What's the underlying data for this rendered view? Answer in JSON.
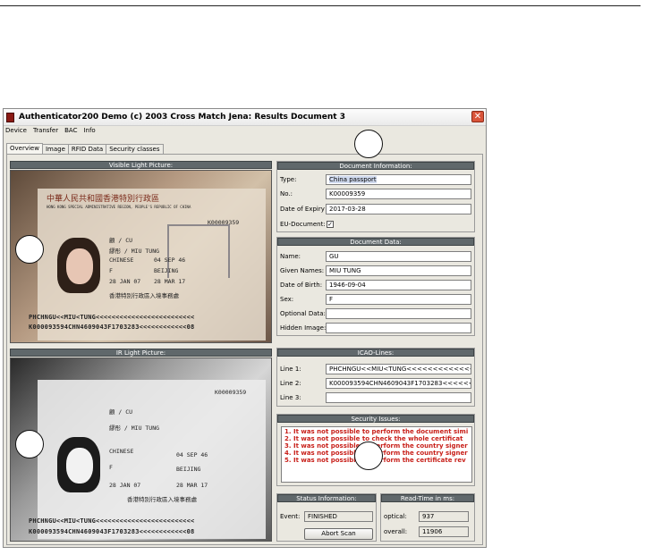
{
  "window": {
    "title": "Authenticator200 Demo (c) 2003 Cross Match Jena: Results Document 3",
    "close_glyph": "✕"
  },
  "menu": [
    "Device",
    "Transfer",
    "BAC",
    "Info"
  ],
  "tabs": [
    "Overview",
    "Image",
    "RFID Data",
    "Security classes"
  ],
  "visible_light": {
    "header": "Visible Light Picture:",
    "mrz1": "PHCHNGU<<MIU<TUNG<<<<<<<<<<<<<<<<<<<<<<<<<",
    "mrz2": "K000093594CHN4609043F1703283<<<<<<<<<<<<08",
    "passport_title": "中華人民共和國香港特別行政區",
    "passport_subtitle": "HONG KONG SPECIAL ADMINISTRATIVE REGION, PEOPLE'S REPUBLIC OF CHINA",
    "name_cn": "顧 / CU",
    "name_en": "繆彤 / MIU TUNG",
    "nationality": "CHINESE",
    "dob": "04 SEP 46",
    "sex": "F",
    "place": "BEIJING",
    "issue": "28 JAN 07",
    "expiry": "28 MAR 17",
    "number": "K00009359",
    "authority": "香港特別行政區入境事務處"
  },
  "ir_light": {
    "header": "IR Light Picture:",
    "mrz1": "PHCHNGU<<MIU<TUNG<<<<<<<<<<<<<<<<<<<<<<<<<",
    "mrz2": "K000093594CHN4609043F1703283<<<<<<<<<<<<08",
    "name_cn": "顧 / CU",
    "name_en": "繆彤 / MIU TUNG",
    "nationality": "CHINESE",
    "dob": "04 SEP 46",
    "sex": "F",
    "place": "BEIJING",
    "issue": "28 JAN 07",
    "expiry": "28 MAR 17",
    "number": "K00009359",
    "authority": "香港特別行政區入境事務處"
  },
  "document_information": {
    "header": "Document Information:",
    "type_label": "Type:",
    "type_value": "China passport",
    "no_label": "No.:",
    "no_value": "K00009359",
    "expiry_label": "Date of Expiry",
    "expiry_value": "2017-03-28",
    "eu_label": "EU-Document:",
    "eu_checked": "✓"
  },
  "document_data": {
    "header": "Document Data:",
    "name_label": "Name:",
    "name_value": "GU",
    "given_label": "Given Names:",
    "given_value": "MIU TUNG",
    "dob_label": "Date of Birth:",
    "dob_value": "1946-09-04",
    "sex_label": "Sex:",
    "sex_value": "F",
    "optional_label": "Optional Data:",
    "optional_value": "",
    "hidden_label": "Hidden Image:",
    "hidden_value": ""
  },
  "icao": {
    "header": "ICAO-Lines:",
    "line1_label": "Line 1:",
    "line1_value": "PHCHNGU<<MIU<TUNG<<<<<<<<<<<<<<<<<<<<<<<<<",
    "line2_label": "Line 2:",
    "line2_value": "K000093594CHN4609043F1703283<<<<<<<<<<<<08",
    "line3_label": "Line 3:",
    "line3_value": ""
  },
  "security": {
    "header": "Security Issues:",
    "issues": [
      "1. It was not possible to perform the document simi",
      "2. It was not possible to check the whole certificat",
      "3. It was not possible to perform the country signer",
      "4. It was not possible to perform the country signer",
      "5. It was not possible to perform the certificate rev"
    ]
  },
  "status": {
    "header": "Status Information:",
    "event_label": "Event:",
    "event_value": "FINISHED",
    "abort_label": "Abort Scan"
  },
  "readtime": {
    "header": "Read-Time in ms:",
    "optical_label": "optical:",
    "optical_value": "937",
    "overall_label": "overall:",
    "overall_value": "11906"
  },
  "colors": {
    "issue_text": "#c8201a",
    "panel_header": "#60686b",
    "window_bg": "#eae8e0"
  }
}
